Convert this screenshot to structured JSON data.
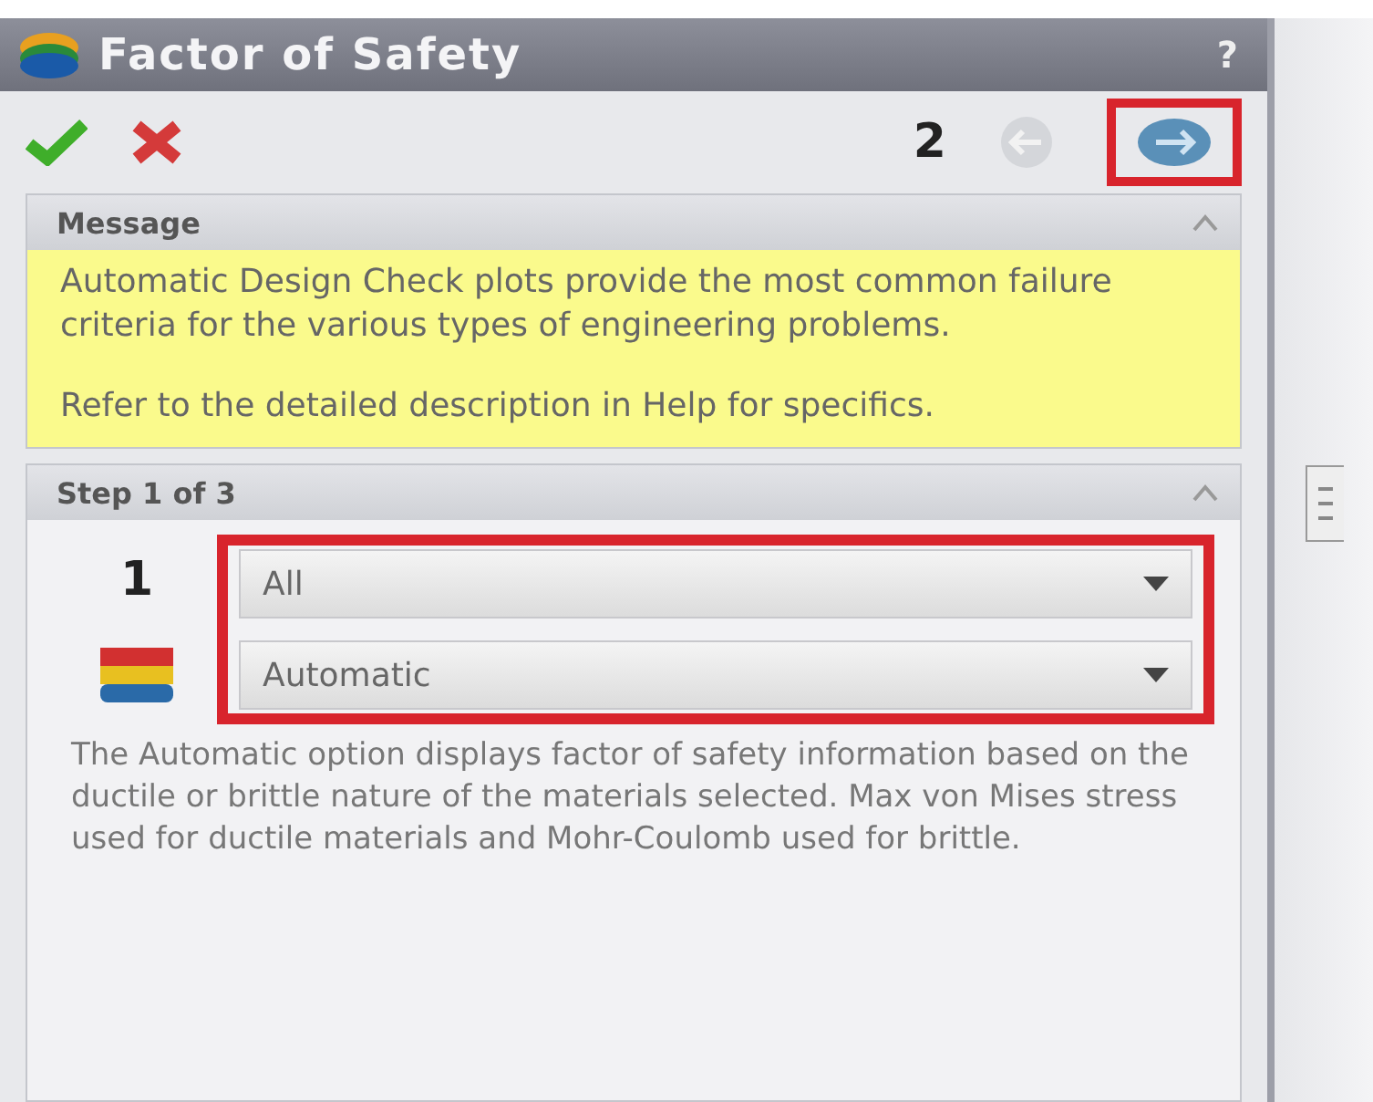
{
  "panel": {
    "title": "Factor of Safety",
    "help": "?"
  },
  "toolbar": {
    "step_number": "2",
    "next_highlighted": true
  },
  "message": {
    "title": "Message",
    "paragraphs": [
      "Automatic Design Check plots provide the most common failure criteria for the various types of engineering problems.",
      "Refer to the detailed description in Help for specifics."
    ]
  },
  "step": {
    "title": "Step 1 of 3",
    "number": "1",
    "highlighted": true,
    "dropdowns": [
      {
        "value": "All"
      },
      {
        "value": "Automatic"
      }
    ],
    "description": "The Automatic option displays factor of safety information based on the ductile or brittle nature of the materials selected. Max von Mises stress used for ductile materials and Mohr-Coulomb used for brittle."
  }
}
